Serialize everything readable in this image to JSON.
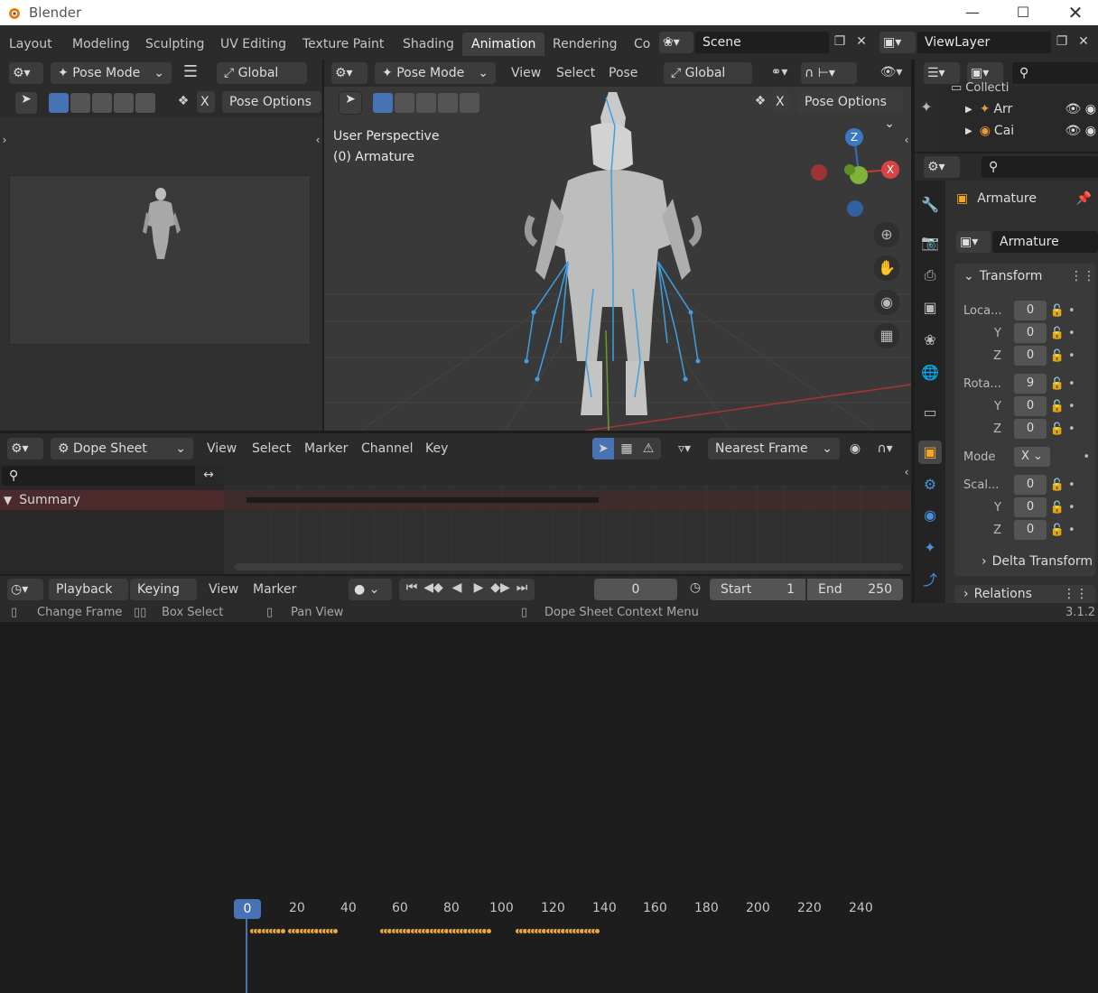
{
  "app": {
    "title": "Blender",
    "version": "3.1.2"
  },
  "workspace_tabs": [
    "Layout",
    "Modeling",
    "Sculpting",
    "UV Editing",
    "Texture Paint",
    "Shading",
    "Animation",
    "Rendering",
    "Co"
  ],
  "active_tab": "Animation",
  "scene": {
    "label": "Scene"
  },
  "view_layer": {
    "label": "ViewLayer"
  },
  "left_view": {
    "mode": "Pose Mode",
    "orientation": "Global",
    "pose_options": "Pose Options",
    "x_label": "X"
  },
  "viewport": {
    "mode": "Pose Mode",
    "menu": [
      "View",
      "Select",
      "Pose"
    ],
    "orientation": "Global",
    "pose_options": "Pose Options",
    "x_label": "X",
    "info_line1": "User Perspective",
    "info_line2": "(0) Armature",
    "gizmo": {
      "z": "Z",
      "x": "X"
    }
  },
  "outliner": {
    "items": [
      {
        "label": "Collecti"
      },
      {
        "label": "Arr"
      },
      {
        "label": "Cai"
      }
    ]
  },
  "properties": {
    "object_name": "Armature",
    "data_name": "Armature",
    "transform_label": "Transform",
    "location_label": "Loca...",
    "rotation_label": "Rota...",
    "scale_label": "Scal...",
    "y_label": "Y",
    "z_label": "Z",
    "mode_label": "Mode",
    "mode_value": "X",
    "location": [
      "0",
      "0",
      "0"
    ],
    "rotation": [
      "9",
      "0",
      "0"
    ],
    "scale": [
      "0",
      "0",
      "0"
    ],
    "delta_label": "Delta Transform",
    "relations_label": "Relations"
  },
  "dopesheet": {
    "editor": "Dope Sheet",
    "menu": [
      "View",
      "Select",
      "Marker",
      "Channel",
      "Key"
    ],
    "snap": "Nearest Frame",
    "summary_label": "Summary",
    "current_frame": "0",
    "ticks": [
      "20",
      "40",
      "60",
      "80",
      "100",
      "120",
      "140",
      "160",
      "180",
      "200",
      "220",
      "240"
    ]
  },
  "timeline": {
    "menu": [
      "Playback",
      "Keying",
      "View",
      "Marker"
    ],
    "frame": "0",
    "start_label": "Start",
    "start_value": "1",
    "end_label": "End",
    "end_value": "250"
  },
  "statusbar": {
    "change_frame": "Change Frame",
    "box_select": "Box Select",
    "pan_view": "Pan View",
    "context_menu": "Dope Sheet Context Menu"
  },
  "colors": {
    "accent": "#4772b3",
    "keyframe": "#e8a93a",
    "summary_bg": "#4a2a2a",
    "bones": "#3ea0e0"
  }
}
